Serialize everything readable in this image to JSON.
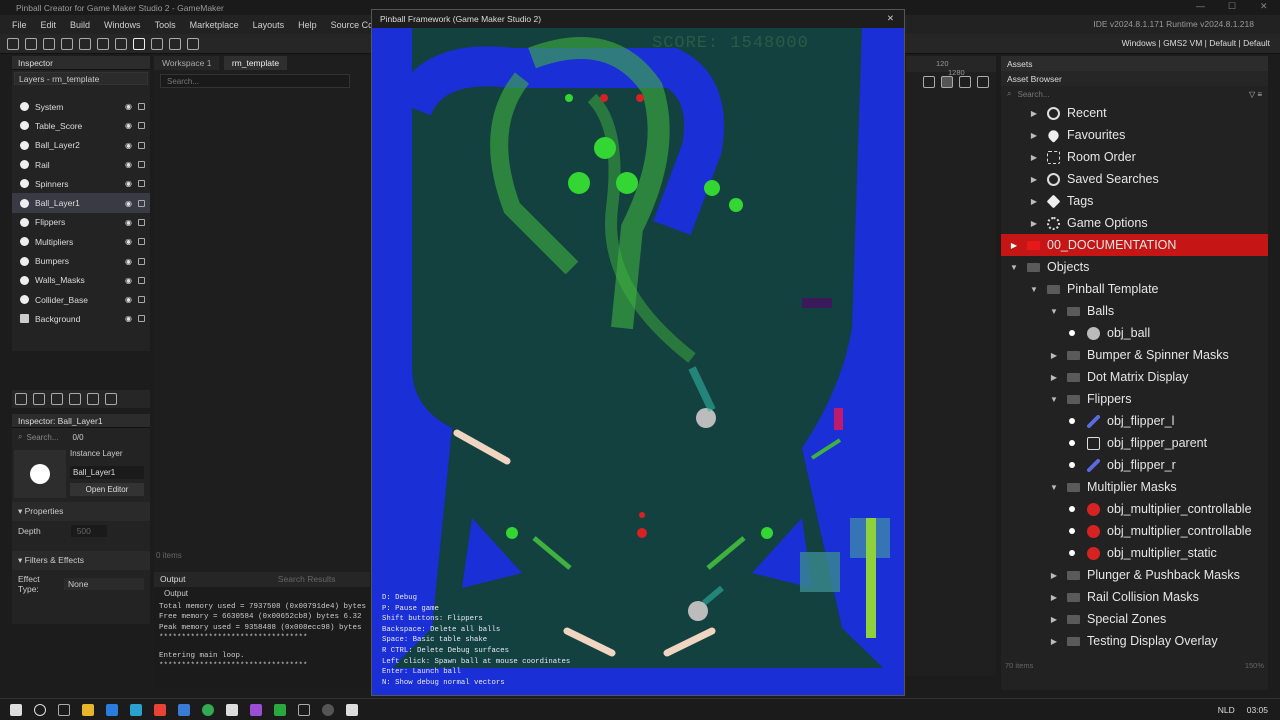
{
  "window_title": "Pinball Creator for Game Maker Studio 2 - GameMaker",
  "menu": [
    "File",
    "Edit",
    "Build",
    "Windows",
    "Tools",
    "Marketplace",
    "Layouts",
    "Help",
    "Source Cont"
  ],
  "ide_version": "IDE v2024.8.1.171  Runtime v2024.8.1.218",
  "target_info": "Windows | GMS2 VM | Default | Default",
  "inspector": {
    "title": "Inspector",
    "layers_label": "Layers - rm_template",
    "layers": [
      "System",
      "Table_Score",
      "Ball_Layer2",
      "Rail",
      "Spinners",
      "Ball_Layer1",
      "Flippers",
      "Multipliers",
      "Bumpers",
      "Walls_Masks",
      "Collider_Base",
      "Background"
    ],
    "selected_layer": "Ball_Layer1"
  },
  "inspector2": {
    "title": "Inspector: Ball_Layer1",
    "search_placeholder": "Search...",
    "count": "0/0",
    "instance_layer_label": "Instance Layer",
    "layer_name": "Ball_Layer1",
    "open_editor": "Open Editor",
    "properties": "Properties",
    "depth_label": "Depth",
    "depth_value": "500",
    "filters": "Filters & Effects",
    "effect_type_label": "Effect Type:",
    "effect_type_value": "None"
  },
  "workspace": {
    "tabs": [
      "Workspace 1",
      "rm_template"
    ],
    "search_placeholder": "Search...",
    "items_count": "0 items"
  },
  "output": {
    "tabs": [
      "Output",
      "Search Results"
    ],
    "subtitle": "Output",
    "lines": [
      "Total memory used = 7937508 (0x00791de4) bytes",
      "Free memory = 6630584 (0x00652cb8) bytes 6.32",
      "Peak memory used = 9358488 (0x008ecc98) bytes",
      "*********************************",
      "Entering main loop.",
      "*********************************"
    ]
  },
  "game": {
    "title": "Pinball Framework (Game Maker Studio 2)",
    "score": "SCORE: 1548000",
    "controls": [
      "D: Debug",
      "P: Pause game",
      "Shift buttons: Flippers",
      "Backspace: Delete all balls",
      "Space: Basic table shake",
      "R CTRL: Delete Debug surfaces",
      "Left click: Spawn ball at mouse coordinates",
      "Enter: Launch ball",
      "N: Show debug normal vectors"
    ]
  },
  "ruler": [
    "120",
    "1280"
  ],
  "assets": {
    "title": "Assets",
    "subtitle": "Asset Browser",
    "search_placeholder": "Search...",
    "items": [
      {
        "label": "Recent",
        "icon": "clock-icon",
        "level": 1,
        "arrow": "right"
      },
      {
        "label": "Favourites",
        "icon": "heart-icon",
        "level": 1,
        "arrow": "right"
      },
      {
        "label": "Room Order",
        "icon": "room-order-icon",
        "level": 1,
        "arrow": "right"
      },
      {
        "label": "Saved Searches",
        "icon": "search-icon",
        "level": 1,
        "arrow": "right"
      },
      {
        "label": "Tags",
        "icon": "tag-icon",
        "level": 1,
        "arrow": "right"
      },
      {
        "label": "Game Options",
        "icon": "gear-icon",
        "level": 1,
        "arrow": "right"
      },
      {
        "label": "00_DOCUMENTATION",
        "icon": "folder-icon",
        "level": 0,
        "arrow": "right",
        "highlight": true
      },
      {
        "label": "Objects",
        "icon": "folder-icon",
        "level": 0,
        "arrow": "down"
      },
      {
        "label": "Pinball Template",
        "icon": "folder-icon",
        "level": 1,
        "arrow": "down"
      },
      {
        "label": "Balls",
        "icon": "folder-icon",
        "level": 2,
        "arrow": "down"
      },
      {
        "label": "obj_ball",
        "icon": "ball-icon",
        "level": 3,
        "arrow": "bullet"
      },
      {
        "label": "Bumper & Spinner Masks",
        "icon": "folder-icon",
        "level": 2,
        "arrow": "right"
      },
      {
        "label": "Dot Matrix Display",
        "icon": "folder-icon",
        "level": 2,
        "arrow": "right"
      },
      {
        "label": "Flippers",
        "icon": "folder-icon",
        "level": 2,
        "arrow": "down"
      },
      {
        "label": "obj_flipper_l",
        "icon": "flipper-icon",
        "level": 3,
        "arrow": "bullet"
      },
      {
        "label": "obj_flipper_parent",
        "icon": "empty-object-icon",
        "level": 3,
        "arrow": "bullet"
      },
      {
        "label": "obj_flipper_r",
        "icon": "flipper-icon",
        "level": 3,
        "arrow": "bullet"
      },
      {
        "label": "Multiplier Masks",
        "icon": "folder-icon",
        "level": 2,
        "arrow": "down"
      },
      {
        "label": "obj_multiplier_controllable",
        "icon": "multiplier-icon",
        "level": 3,
        "arrow": "bullet"
      },
      {
        "label": "obj_multiplier_controllable",
        "icon": "multiplier-icon",
        "level": 3,
        "arrow": "bullet"
      },
      {
        "label": "obj_multiplier_static",
        "icon": "multiplier-static-icon",
        "level": 3,
        "arrow": "bullet"
      },
      {
        "label": "Plunger & Pushback Masks",
        "icon": "folder-icon",
        "level": 2,
        "arrow": "right"
      },
      {
        "label": "Rail Collision Masks",
        "icon": "folder-icon",
        "level": 2,
        "arrow": "right"
      },
      {
        "label": "Special Zones",
        "icon": "folder-icon",
        "level": 2,
        "arrow": "right"
      },
      {
        "label": "Testing Display Overlay",
        "icon": "folder-icon",
        "level": 2,
        "arrow": "right"
      }
    ],
    "items_count": "70 items",
    "zoom": "150%"
  },
  "taskbar": {
    "lang": "NLD",
    "time": "03:05"
  },
  "colors": {
    "accent": "#c51515",
    "game_bg": "#0e3a3a",
    "table_blue": "#1a2fd6",
    "rail_green": "#3fb13f"
  }
}
